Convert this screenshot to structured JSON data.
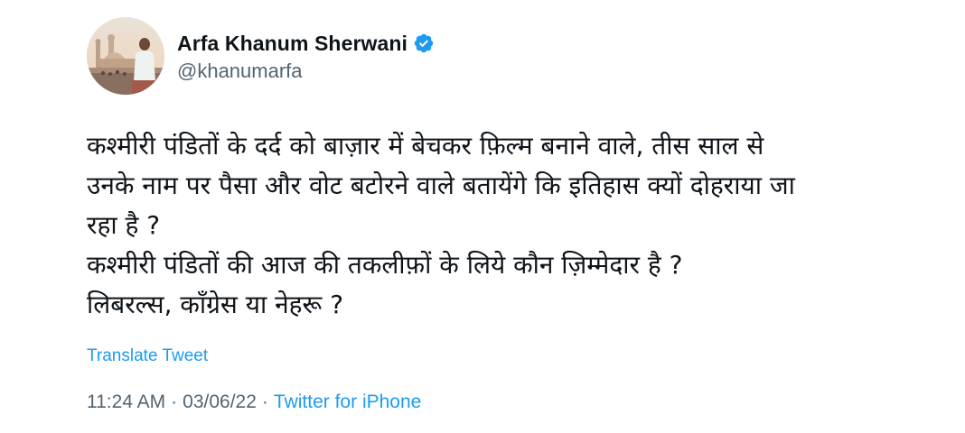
{
  "author": {
    "display_name": "Arfa Khanum Sherwani",
    "handle": "@khanumarfa",
    "verified_icon": "verified-badge-icon",
    "avatar": "avatar-photo"
  },
  "tweet": {
    "lines": [
      "कश्मीरी पंडितों के दर्द को बाज़ार में बेचकर फ़िल्म बनाने वाले, तीस साल से",
      "उनके नाम पर पैसा और वोट बटोरने वाले बतायेंगे कि इतिहास क्यों दोहराया जा",
      "रहा है ?",
      "कश्मीरी पंडितों की आज की तकलीफ़ों के लिये कौन ज़िम्मेदार है ?",
      "लिबरल्स, कॉंग्रेस या नेहरू ?"
    ],
    "translate_label": "Translate Tweet",
    "time": "11:24 AM",
    "date": "03/06/22",
    "source": "Twitter for iPhone",
    "separator": "·"
  },
  "colors": {
    "text": "#0f1419",
    "secondary": "#536471",
    "accent": "#1d9bf0"
  }
}
